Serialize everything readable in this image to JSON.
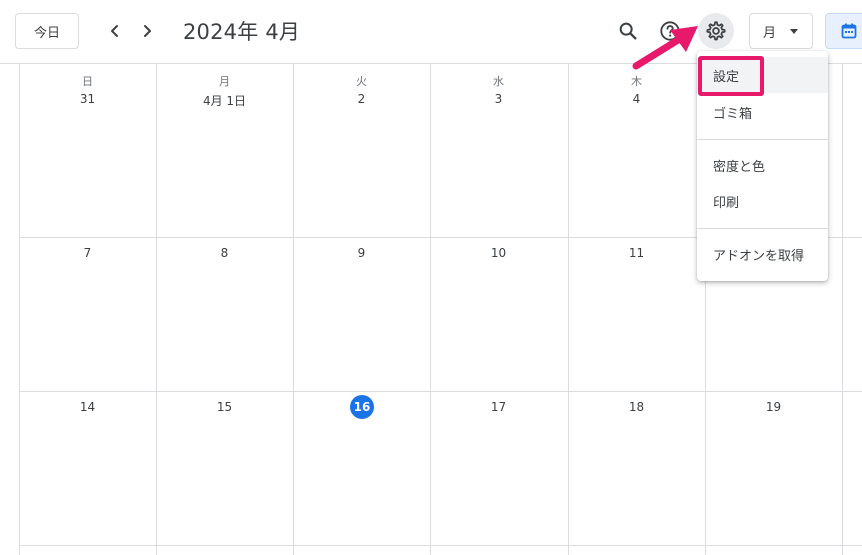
{
  "header": {
    "today_label": "今日",
    "title": "2024年 4月",
    "view_label": "月"
  },
  "calendar": {
    "weekdays": [
      "日",
      "月",
      "火",
      "水",
      "木"
    ],
    "weeks": [
      [
        "31",
        "4月 1日",
        "2",
        "3",
        "4"
      ],
      [
        "7",
        "8",
        "9",
        "10",
        "11"
      ],
      [
        "14",
        "15",
        "16",
        "17",
        "18",
        "19"
      ]
    ],
    "today": "16"
  },
  "menu": {
    "items": [
      {
        "label": "設定"
      },
      {
        "label": "ゴミ箱"
      },
      {
        "label": "密度と色"
      },
      {
        "label": "印刷"
      },
      {
        "label": "アドオンを取得"
      }
    ]
  },
  "colors": {
    "accent": "#1a73e8",
    "annotation": "#e8196a"
  },
  "icons": [
    "chevron-left-icon",
    "chevron-right-icon",
    "search-icon",
    "help-icon",
    "gear-icon",
    "calendar-icon"
  ]
}
